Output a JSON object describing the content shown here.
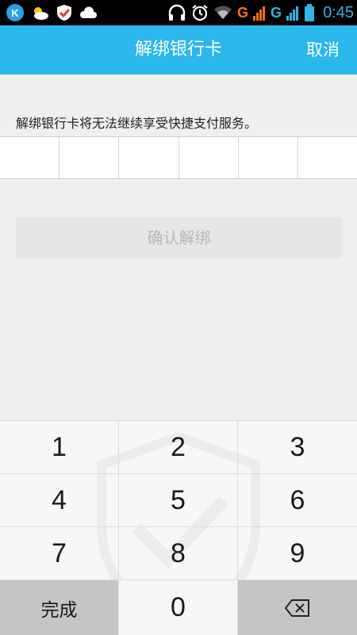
{
  "status_bar": {
    "time": "0:45",
    "network1": "G",
    "network2": "G"
  },
  "header": {
    "title": "解绑银行卡",
    "cancel_label": "取消"
  },
  "main": {
    "notice": "解绑银行卡将无法继续享受快捷支付服务。",
    "confirm_label": "确认解绑"
  },
  "keypad": {
    "keys": [
      "1",
      "2",
      "3",
      "4",
      "5",
      "6",
      "7",
      "8",
      "9"
    ],
    "done_label": "完成",
    "zero_label": "0"
  },
  "colors": {
    "title_bar": "#2bb6ec",
    "clock": "#33b5e5",
    "signal_orange": "#ff6b1a"
  }
}
